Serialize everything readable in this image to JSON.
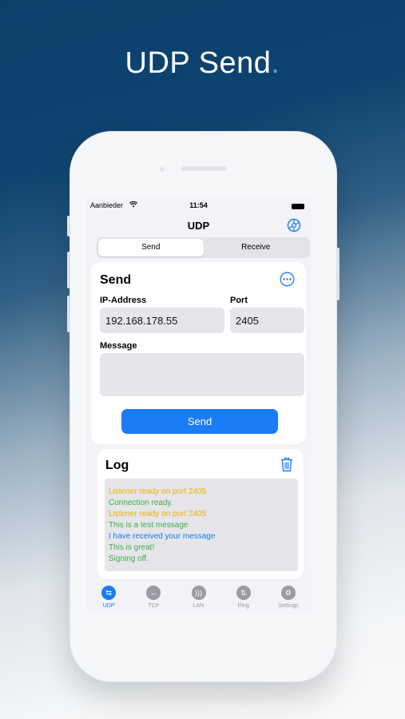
{
  "headline": {
    "text": "UDP Send",
    "dot": "."
  },
  "status": {
    "carrier": "Aanbieder",
    "time": "11:54"
  },
  "nav": {
    "title": "UDP"
  },
  "segment": {
    "items": [
      "Send",
      "Receive"
    ],
    "selected": "Send"
  },
  "send_card": {
    "title": "Send",
    "ip_label": "IP-Address",
    "ip_value": "192.168.178.55",
    "port_label": "Port",
    "port_value": "2405",
    "message_label": "Message",
    "message_value": "",
    "send_button": "Send"
  },
  "log_card": {
    "title": "Log",
    "lines": [
      {
        "text": "Listener ready on port 2405",
        "color": "#f0b400"
      },
      {
        "text": "Connection ready.",
        "color": "#3cb043"
      },
      {
        "text": "Listener ready on port 2405",
        "color": "#f0b400"
      },
      {
        "text": "This is a test message",
        "color": "#3cb043"
      },
      {
        "text": "I have received your message",
        "color": "#1a7cf5"
      },
      {
        "text": "This is great!",
        "color": "#3cb043"
      },
      {
        "text": "Signing off.",
        "color": "#3cb043"
      }
    ]
  },
  "tabs": [
    {
      "label": "UDP",
      "icon": "udp-arrows-icon",
      "active": true
    },
    {
      "label": "TCP",
      "icon": "tcp-arrows-icon",
      "active": false
    },
    {
      "label": "LAN",
      "icon": "lan-signal-icon",
      "active": false
    },
    {
      "label": "Ping",
      "icon": "ping-arrows-icon",
      "active": false
    },
    {
      "label": "Settings",
      "icon": "settings-gear-icon",
      "active": false
    }
  ],
  "colors": {
    "accent": "#1a7cf5",
    "field_bg": "#e5e5ea",
    "screen_bg": "#f2f2f7"
  }
}
